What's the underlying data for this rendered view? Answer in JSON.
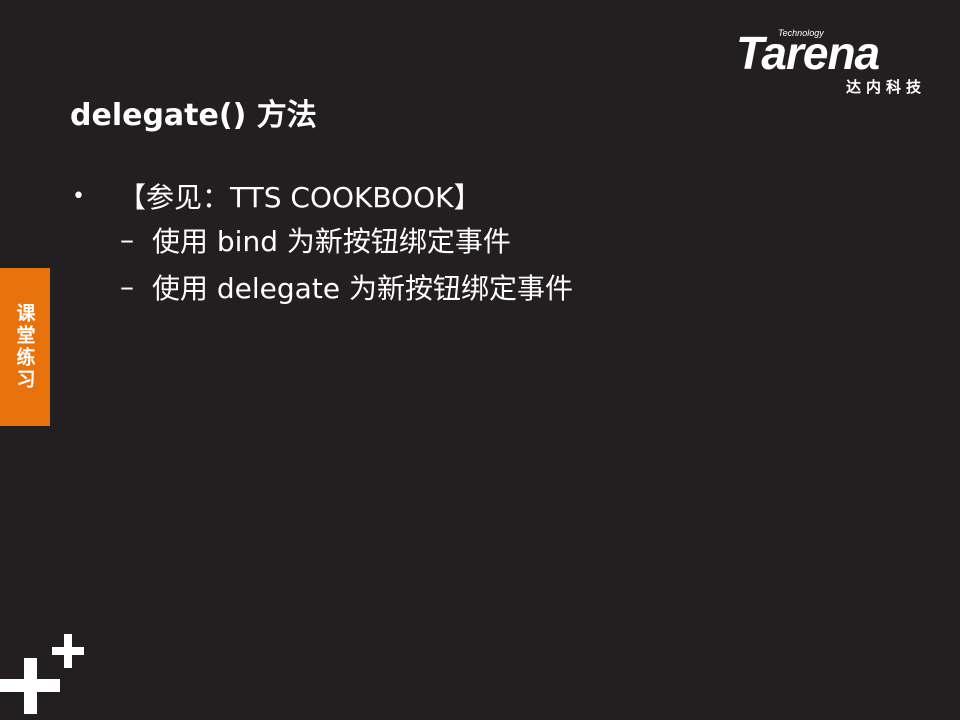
{
  "logo": {
    "tagline": "Technology",
    "wordmark": "Tarena",
    "chinese_name": "达内科技"
  },
  "slide": {
    "title": "delegate() 方法",
    "bullets": [
      {
        "marker": "•",
        "text": "【参见：TTS COOKBOOK】",
        "subitems": [
          {
            "marker": "–",
            "text": "使用 bind 为新按钮绑定事件"
          },
          {
            "marker": "–",
            "text": "使用 delegate 为新按钮绑定事件"
          }
        ]
      }
    ]
  },
  "side_tag": {
    "label": "课堂练习"
  },
  "decoration": {
    "icon": "plus-icon"
  },
  "colors": {
    "background": "#231f20",
    "accent": "#e8720c",
    "text": "#ffffff"
  }
}
